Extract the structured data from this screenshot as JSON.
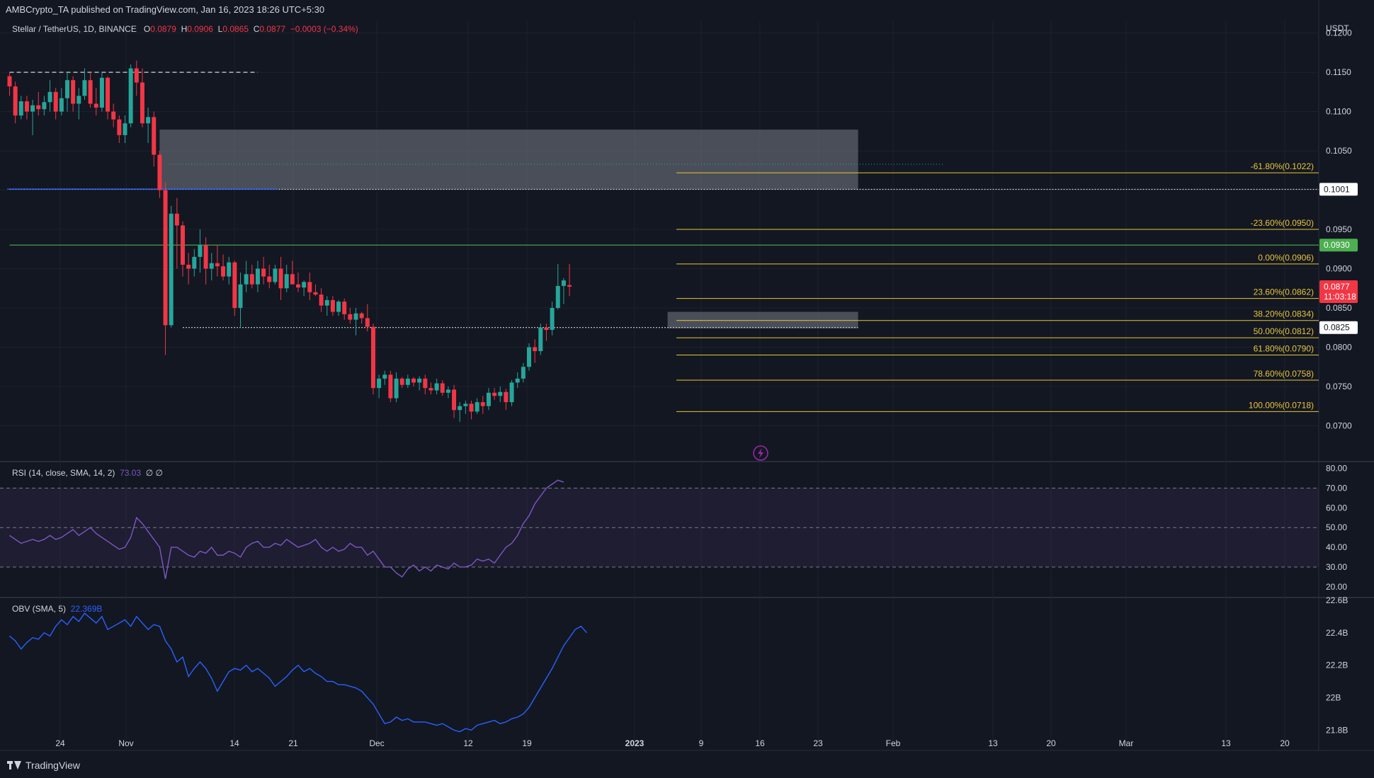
{
  "header": {
    "publisher_line": "AMBCrypto_TA published on TradingView.com, Jan 16, 2023 18:26 UTC+5:30"
  },
  "legend": {
    "symbol": "Stellar / TetherUS, 1D, BINANCE",
    "o_label": "O",
    "o_value": "0.0879",
    "h_label": "H",
    "h_value": "0.0906",
    "l_label": "L",
    "l_value": "0.0865",
    "c_label": "C",
    "c_value": "0.0877",
    "change": "−0.0003 (−0.34%)"
  },
  "rsi_legend": {
    "label": "RSI (14, close, SMA, 14, 2)",
    "value": "73.03",
    "extra": "∅ ∅"
  },
  "obv_legend": {
    "label": "OBV (SMA, 5)",
    "value": "22.369B"
  },
  "footer": {
    "brand": "TradingView"
  },
  "colors": {
    "bg": "#131722",
    "up": "#26a69a",
    "down": "#f23645",
    "fib": "#e8c53a",
    "rsi": "#7e57c2",
    "obv": "#2962ff",
    "text": "#d1d4dc",
    "green_label": "#4caf50"
  },
  "chart_data": {
    "type": "candlestick",
    "price_axis": {
      "unit": "USDT",
      "ticks": [
        "0.1200",
        "0.1150",
        "0.1100",
        "0.1050",
        "0.1000",
        "0.0950",
        "0.0900",
        "0.0850",
        "0.0800",
        "0.0750",
        "0.0700"
      ],
      "ylim": [
        0.0658,
        0.1215
      ]
    },
    "time_axis": {
      "ticks": [
        "24",
        "Nov",
        "14",
        "21",
        "Dec",
        "12",
        "19",
        "2023",
        "9",
        "16",
        "23",
        "Feb",
        "13",
        "20",
        "Mar",
        "13",
        "20"
      ]
    },
    "candles": [
      [
        0.1145,
        0.115,
        0.112,
        0.1132
      ],
      [
        0.1132,
        0.1138,
        0.1085,
        0.1095
      ],
      [
        0.1095,
        0.112,
        0.109,
        0.1113
      ],
      [
        0.1113,
        0.112,
        0.109,
        0.11
      ],
      [
        0.11,
        0.1115,
        0.107,
        0.1108
      ],
      [
        0.1108,
        0.1125,
        0.1095,
        0.1103
      ],
      [
        0.1103,
        0.112,
        0.1095,
        0.1112
      ],
      [
        0.1112,
        0.114,
        0.11,
        0.1125
      ],
      [
        0.1125,
        0.113,
        0.109,
        0.11
      ],
      [
        0.11,
        0.113,
        0.1095,
        0.1117
      ],
      [
        0.1117,
        0.115,
        0.11,
        0.114
      ],
      [
        0.114,
        0.1145,
        0.11,
        0.111
      ],
      [
        0.111,
        0.113,
        0.109,
        0.112
      ],
      [
        0.112,
        0.1155,
        0.1115,
        0.114
      ],
      [
        0.114,
        0.115,
        0.1105,
        0.111
      ],
      [
        0.111,
        0.113,
        0.1095,
        0.1105
      ],
      [
        0.1105,
        0.115,
        0.11,
        0.1143
      ],
      [
        0.1143,
        0.1145,
        0.109,
        0.11
      ],
      [
        0.11,
        0.111,
        0.108,
        0.109
      ],
      [
        0.109,
        0.1095,
        0.106,
        0.107
      ],
      [
        0.107,
        0.1095,
        0.106,
        0.1085
      ],
      [
        0.1085,
        0.116,
        0.108,
        0.1155
      ],
      [
        0.1155,
        0.1165,
        0.112,
        0.1137
      ],
      [
        0.1137,
        0.1155,
        0.108,
        0.1085
      ],
      [
        0.1085,
        0.1105,
        0.106,
        0.1093
      ],
      [
        0.1093,
        0.11,
        0.103,
        0.1045
      ],
      [
        0.1045,
        0.105,
        0.099,
        0.1
      ],
      [
        0.1,
        0.101,
        0.079,
        0.0828
      ],
      [
        0.0828,
        0.098,
        0.0825,
        0.097
      ],
      [
        0.097,
        0.099,
        0.09,
        0.0955
      ],
      [
        0.0955,
        0.096,
        0.089,
        0.0905
      ],
      [
        0.0905,
        0.092,
        0.088,
        0.09
      ],
      [
        0.09,
        0.0925,
        0.089,
        0.0915
      ],
      [
        0.0915,
        0.095,
        0.0895,
        0.093
      ],
      [
        0.093,
        0.094,
        0.088,
        0.09
      ],
      [
        0.09,
        0.092,
        0.0885,
        0.0907
      ],
      [
        0.0907,
        0.093,
        0.089,
        0.0903
      ],
      [
        0.0903,
        0.0918,
        0.0885,
        0.089
      ],
      [
        0.089,
        0.0915,
        0.088,
        0.0908
      ],
      [
        0.0908,
        0.091,
        0.084,
        0.085
      ],
      [
        0.085,
        0.0895,
        0.0825,
        0.088
      ],
      [
        0.088,
        0.091,
        0.087,
        0.0893
      ],
      [
        0.0893,
        0.0905,
        0.0875,
        0.088
      ],
      [
        0.088,
        0.091,
        0.087,
        0.09
      ],
      [
        0.09,
        0.0915,
        0.088,
        0.089
      ],
      [
        0.089,
        0.0905,
        0.0875,
        0.0883
      ],
      [
        0.0883,
        0.0905,
        0.088,
        0.09
      ],
      [
        0.09,
        0.0915,
        0.086,
        0.0875
      ],
      [
        0.0875,
        0.0905,
        0.087,
        0.0893
      ],
      [
        0.0893,
        0.091,
        0.088,
        0.088
      ],
      [
        0.088,
        0.0895,
        0.087,
        0.0876
      ],
      [
        0.0876,
        0.0885,
        0.0865,
        0.0883
      ],
      [
        0.0883,
        0.0895,
        0.086,
        0.087
      ],
      [
        0.087,
        0.088,
        0.0865,
        0.0867
      ],
      [
        0.0867,
        0.0875,
        0.0845,
        0.0853
      ],
      [
        0.0853,
        0.0865,
        0.084,
        0.086
      ],
      [
        0.086,
        0.0865,
        0.084,
        0.0845
      ],
      [
        0.0845,
        0.086,
        0.084,
        0.0858
      ],
      [
        0.0858,
        0.0862,
        0.0835,
        0.0842
      ],
      [
        0.0842,
        0.085,
        0.083,
        0.0835
      ],
      [
        0.0835,
        0.085,
        0.0815,
        0.0843
      ],
      [
        0.0843,
        0.0845,
        0.083,
        0.0837
      ],
      [
        0.0837,
        0.0855,
        0.082,
        0.0826
      ],
      [
        0.0826,
        0.083,
        0.074,
        0.0748
      ],
      [
        0.0748,
        0.0765,
        0.0735,
        0.076
      ],
      [
        0.076,
        0.077,
        0.0752,
        0.0765
      ],
      [
        0.0765,
        0.077,
        0.073,
        0.0735
      ],
      [
        0.0735,
        0.0768,
        0.073,
        0.076
      ],
      [
        0.076,
        0.0762,
        0.0748,
        0.0752
      ],
      [
        0.0752,
        0.0765,
        0.0748,
        0.076
      ],
      [
        0.076,
        0.0762,
        0.075,
        0.0755
      ],
      [
        0.0755,
        0.0763,
        0.0745,
        0.076
      ],
      [
        0.076,
        0.0765,
        0.074,
        0.0748
      ],
      [
        0.0748,
        0.0755,
        0.074,
        0.0745
      ],
      [
        0.0745,
        0.076,
        0.074,
        0.0754
      ],
      [
        0.0754,
        0.0758,
        0.0738,
        0.0742
      ],
      [
        0.0742,
        0.075,
        0.0735,
        0.0746
      ],
      [
        0.0746,
        0.0752,
        0.071,
        0.072
      ],
      [
        0.072,
        0.073,
        0.0705,
        0.0725
      ],
      [
        0.0725,
        0.0732,
        0.0715,
        0.0728
      ],
      [
        0.0728,
        0.0732,
        0.0708,
        0.0718
      ],
      [
        0.0718,
        0.0735,
        0.0715,
        0.073
      ],
      [
        0.073,
        0.0738,
        0.0715,
        0.0725
      ],
      [
        0.0725,
        0.0748,
        0.072,
        0.0742
      ],
      [
        0.0742,
        0.0748,
        0.0733,
        0.0738
      ],
      [
        0.0738,
        0.075,
        0.073,
        0.0743
      ],
      [
        0.0743,
        0.0747,
        0.072,
        0.073
      ],
      [
        0.073,
        0.0758,
        0.0725,
        0.0755
      ],
      [
        0.0755,
        0.0768,
        0.0748,
        0.076
      ],
      [
        0.076,
        0.078,
        0.0755,
        0.0775
      ],
      [
        0.0775,
        0.0805,
        0.077,
        0.08
      ],
      [
        0.08,
        0.081,
        0.078,
        0.0795
      ],
      [
        0.0795,
        0.083,
        0.079,
        0.0825
      ],
      [
        0.0825,
        0.083,
        0.0808,
        0.0822
      ],
      [
        0.0822,
        0.0858,
        0.0815,
        0.085
      ],
      [
        0.085,
        0.0906,
        0.0848,
        0.0878
      ],
      [
        0.0878,
        0.0888,
        0.0855,
        0.0885
      ],
      [
        0.0879,
        0.0906,
        0.0865,
        0.0877
      ]
    ],
    "fibonacci": [
      {
        "label": "-61.80%(0.1022)",
        "value": 0.1022
      },
      {
        "label": "-23.60%(0.0950)",
        "value": 0.095
      },
      {
        "label": "0.00%(0.0906)",
        "value": 0.0906
      },
      {
        "label": "23.60%(0.0862)",
        "value": 0.0862
      },
      {
        "label": "38.20%(0.0834)",
        "value": 0.0834
      },
      {
        "label": "50.00%(0.0812)",
        "value": 0.0812
      },
      {
        "label": "61.80%(0.0790)",
        "value": 0.079
      },
      {
        "label": "78.60%(0.0758)",
        "value": 0.0758
      },
      {
        "label": "100.00%(0.0718)",
        "value": 0.0718
      }
    ],
    "price_labels": [
      {
        "text": "0.1001",
        "value": 0.1001,
        "style": "white"
      },
      {
        "text": "0.0930",
        "value": 0.093,
        "style": "green"
      },
      {
        "text": "0.0877",
        "value": 0.0877,
        "style": "red",
        "sub": "11:03:18"
      },
      {
        "text": "0.0825",
        "value": 0.0825,
        "style": "white"
      }
    ],
    "zones": [
      {
        "name": "bearish-order-block",
        "from": 0.1001,
        "to": 0.1077,
        "start_index": 26,
        "end_index": 147
      },
      {
        "name": "bullish-breaker",
        "from": 0.0824,
        "to": 0.0845,
        "start_index": 114,
        "end_index": 147
      }
    ],
    "levels": [
      {
        "name": "prior-high-dashed",
        "value": 0.115,
        "start_index": 0,
        "end_index": 43
      },
      {
        "name": "support-dotted",
        "value": 0.0825,
        "start_index": 30,
        "end_index": 147
      },
      {
        "name": "resistance-green",
        "value": 0.093,
        "start_index": 0,
        "end_index": 166
      },
      {
        "name": "resistance-white-dotted",
        "value": 0.1001,
        "start_index": 0,
        "end_index": 166
      }
    ],
    "rsi": {
      "ticks": [
        "80.00",
        "70.00",
        "60.00",
        "50.00",
        "40.00",
        "30.00",
        "20.00"
      ],
      "ylim": [
        16,
        82
      ],
      "upper": 70,
      "lower": 30,
      "values": [
        46,
        44,
        42,
        43,
        44,
        43,
        44,
        46,
        44,
        45,
        47,
        49,
        46,
        48,
        50,
        47,
        45,
        43,
        41,
        39,
        40,
        45,
        55,
        52,
        48,
        44,
        40,
        24,
        40,
        40,
        38,
        36,
        35,
        38,
        37,
        40,
        36,
        36,
        38,
        37,
        35,
        40,
        42,
        43,
        40,
        40,
        42,
        41,
        44,
        42,
        40,
        41,
        42,
        44,
        40,
        38,
        40,
        38,
        39,
        42,
        40,
        40,
        36,
        38,
        34,
        30,
        30,
        27,
        25,
        29,
        31,
        28,
        30,
        28,
        31,
        30,
        29,
        32,
        30,
        30,
        31,
        34,
        33,
        34,
        32,
        36,
        40,
        42,
        46,
        52,
        56,
        62,
        66,
        70,
        72,
        74,
        73
      ]
    },
    "obv": {
      "ticks": [
        "22.6B",
        "22.4B",
        "22.2B",
        "22B",
        "21.8B"
      ],
      "ylim": [
        21.71,
        22.6
      ],
      "values": [
        22.38,
        22.35,
        22.3,
        22.34,
        22.37,
        22.36,
        22.4,
        22.38,
        22.44,
        22.48,
        22.45,
        22.5,
        22.47,
        22.52,
        22.49,
        22.46,
        22.5,
        22.42,
        22.44,
        22.46,
        22.48,
        22.44,
        22.5,
        22.46,
        22.42,
        22.45,
        22.44,
        22.35,
        22.3,
        22.22,
        22.25,
        22.13,
        22.18,
        22.22,
        22.18,
        22.12,
        22.04,
        22.1,
        22.16,
        22.18,
        22.17,
        22.2,
        22.16,
        22.18,
        22.15,
        22.12,
        22.07,
        22.1,
        22.13,
        22.17,
        22.2,
        22.16,
        22.18,
        22.15,
        22.13,
        22.1,
        22.1,
        22.08,
        22.08,
        22.07,
        22.06,
        22.04,
        22.0,
        21.96,
        21.9,
        21.84,
        21.85,
        21.88,
        21.86,
        21.87,
        21.85,
        21.85,
        21.85,
        21.84,
        21.83,
        21.84,
        21.82,
        21.8,
        21.79,
        21.81,
        21.8,
        21.83,
        21.84,
        21.85,
        21.86,
        21.84,
        21.85,
        21.87,
        21.88,
        21.9,
        21.94,
        22.0,
        22.06,
        22.12,
        22.18,
        22.25,
        22.32,
        22.37,
        22.42,
        22.44,
        22.4
      ]
    }
  }
}
